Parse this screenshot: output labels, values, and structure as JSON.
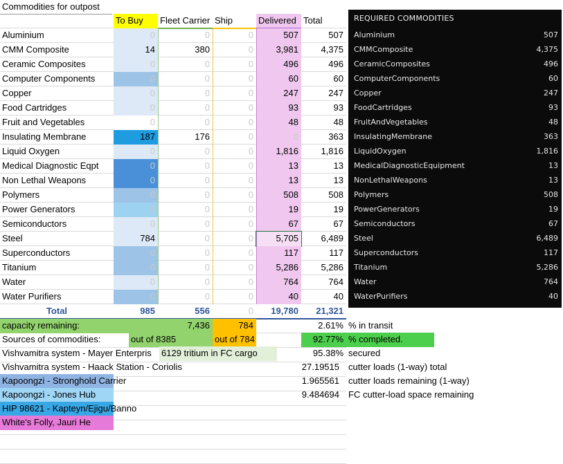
{
  "title": "Commodities for outpost",
  "headers": {
    "to_buy": "To Buy",
    "fleet_carrier": "Fleet Carrier",
    "ship": "Ship",
    "delivered": "Delivered",
    "total": "Total"
  },
  "rows": [
    {
      "name": "Aluminium",
      "to_buy": "0",
      "fc": "0",
      "ship": "0",
      "delivered": "507",
      "total": "507",
      "buy_color": "#dde9f6"
    },
    {
      "name": "CMM Composite",
      "to_buy": "14",
      "fc": "380",
      "ship": "0",
      "delivered": "3,981",
      "total": "4,375",
      "buy_color": "#dde9f6"
    },
    {
      "name": "Ceramic Composites",
      "to_buy": "0",
      "fc": "0",
      "ship": "0",
      "delivered": "496",
      "total": "496",
      "buy_color": "#dde9f6"
    },
    {
      "name": "Computer Components",
      "to_buy": "0",
      "fc": "0",
      "ship": "0",
      "delivered": "60",
      "total": "60",
      "buy_color": "#9dc3e6"
    },
    {
      "name": "Copper",
      "to_buy": "0",
      "fc": "0",
      "ship": "0",
      "delivered": "247",
      "total": "247",
      "buy_color": "#dde9f6"
    },
    {
      "name": "Food Cartridges",
      "to_buy": "0",
      "fc": "0",
      "ship": "0",
      "delivered": "93",
      "total": "93",
      "buy_color": "#dde9f6"
    },
    {
      "name": "Fruit and Vegetables",
      "to_buy": "0",
      "fc": "0",
      "ship": "0",
      "delivered": "48",
      "total": "48",
      "buy_color": "#ffffff"
    },
    {
      "name": "Insulating Membrane",
      "to_buy": "187",
      "fc": "176",
      "ship": "0",
      "delivered": "0",
      "total": "363",
      "buy_color": "#1f9be0"
    },
    {
      "name": "Liquid Oxygen",
      "to_buy": "0",
      "fc": "0",
      "ship": "0",
      "delivered": "1,816",
      "total": "1,816",
      "buy_color": "#dde9f6"
    },
    {
      "name": "Medical Diagnostic Eqpt",
      "to_buy": "0",
      "fc": "0",
      "ship": "0",
      "delivered": "13",
      "total": "13",
      "buy_color": "#4a90d9"
    },
    {
      "name": "Non Lethal Weapons",
      "to_buy": "0",
      "fc": "0",
      "ship": "0",
      "delivered": "13",
      "total": "13",
      "buy_color": "#4a90d9"
    },
    {
      "name": "Polymers",
      "to_buy": "0",
      "fc": "0",
      "ship": "0",
      "delivered": "508",
      "total": "508",
      "buy_color": "#9dc3e6"
    },
    {
      "name": "Power Generators",
      "to_buy": "0",
      "fc": "0",
      "ship": "0",
      "delivered": "19",
      "total": "19",
      "buy_color": "#9dd3f0"
    },
    {
      "name": "Semiconductors",
      "to_buy": "0",
      "fc": "0",
      "ship": "0",
      "delivered": "67",
      "total": "67",
      "buy_color": "#dde9f6"
    },
    {
      "name": "Steel",
      "to_buy": "784",
      "fc": "0",
      "ship": "0",
      "delivered": "5,705",
      "total": "6,489",
      "buy_color": "#dde9f6"
    },
    {
      "name": "Superconductors",
      "to_buy": "0",
      "fc": "0",
      "ship": "0",
      "delivered": "117",
      "total": "117",
      "buy_color": "#9dc3e6"
    },
    {
      "name": "Titanium",
      "to_buy": "0",
      "fc": "0",
      "ship": "0",
      "delivered": "5,286",
      "total": "5,286",
      "buy_color": "#9dc3e6"
    },
    {
      "name": "Water",
      "to_buy": "0",
      "fc": "0",
      "ship": "0",
      "delivered": "764",
      "total": "764",
      "buy_color": "#dde9f6"
    },
    {
      "name": "Water Purifiers",
      "to_buy": "0",
      "fc": "0",
      "ship": "0",
      "delivered": "40",
      "total": "40",
      "buy_color": "#9dc3e6"
    }
  ],
  "totals": {
    "label": "Total",
    "to_buy": "985",
    "fc": "556",
    "ship": "0",
    "delivered": "19,780",
    "total": "21,321"
  },
  "capacity": {
    "label": "capacity remaining:",
    "fc": "7,436",
    "ship": "784",
    "pct": "2.61%",
    "pct_label": "% in transit"
  },
  "sources": {
    "label": "Sources of commodities:",
    "fc": "out of 8385",
    "ship": "out of 784",
    "pct": "92.77%",
    "pct_label": "% completed."
  },
  "secured": {
    "source": "Vishvamitra system - Mayer Enterpris",
    "cargo": "6129 tritium in FC cargo",
    "pct": "95.38%",
    "pct_label": "secured"
  },
  "stats": [
    {
      "source": "Vishvamitra system - Haack Station - Coriolis",
      "value": "27.19515",
      "label": "cutter loads (1-way) total"
    },
    {
      "source": "Kapoongzi - Stronghold Carrier",
      "value": "1.965561",
      "label": "cutter loads remaining (1-way)"
    },
    {
      "source": "Kapoongzi - Jones Hub",
      "value": "9.484694",
      "label": "FC cutter-load space remaining"
    }
  ],
  "extra_sources": [
    "HIP 98621 - Kapteyn/Ejigu/Banno",
    "White's Folly, Jauri He"
  ],
  "panel": {
    "title": "REQUIRED COMMODITIES",
    "items": [
      {
        "name": "Aluminium",
        "value": "507"
      },
      {
        "name": "CMMComposite",
        "value": "4,375"
      },
      {
        "name": "CeramicComposites",
        "value": "496"
      },
      {
        "name": "ComputerComponents",
        "value": "60"
      },
      {
        "name": "Copper",
        "value": "247"
      },
      {
        "name": "FoodCartridges",
        "value": "93"
      },
      {
        "name": "FruitAndVegetables",
        "value": "48"
      },
      {
        "name": "InsulatingMembrane",
        "value": "363"
      },
      {
        "name": "LiquidOxygen",
        "value": "1,816"
      },
      {
        "name": "MedicalDiagnosticEquipment",
        "value": "13"
      },
      {
        "name": "NonLethalWeapons",
        "value": "13"
      },
      {
        "name": "Polymers",
        "value": "508"
      },
      {
        "name": "PowerGenerators",
        "value": "19"
      },
      {
        "name": "Semiconductors",
        "value": "67"
      },
      {
        "name": "Steel",
        "value": "6,489"
      },
      {
        "name": "Superconductors",
        "value": "117"
      },
      {
        "name": "Titanium",
        "value": "5,286"
      },
      {
        "name": "Water",
        "value": "764"
      },
      {
        "name": "WaterPurifiers",
        "value": "40"
      }
    ]
  },
  "colors": {
    "header_yellow": "#ffff00",
    "fc_green": "#e2f0d9",
    "ship_orange": "#ffc000",
    "delivered_pink": "#f0c8ef",
    "capacity_green": "#92d36e",
    "completed_green": "#4ccf4c",
    "secured_green": "#e2f0d9",
    "kapoongzi_blue": "#8fb4e3",
    "jones_blue": "#9fd5f5",
    "hip_blue": "#38a7e6",
    "white_folly_pink": "#e67ad8"
  }
}
